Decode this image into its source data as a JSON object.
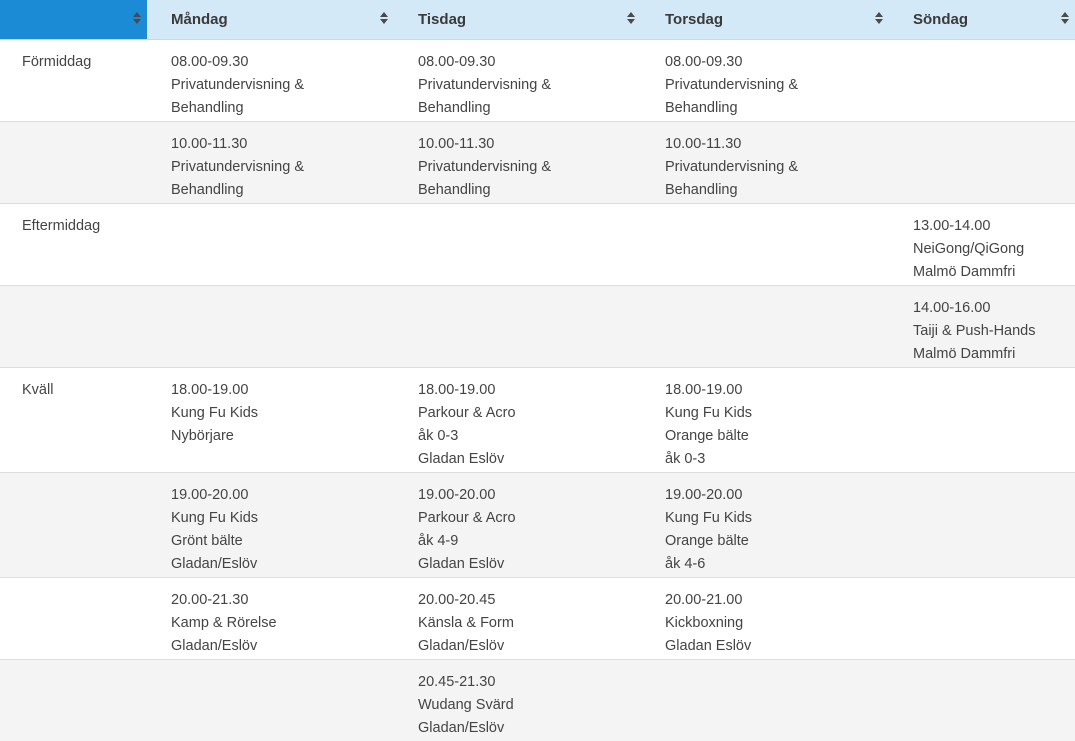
{
  "headers": [
    "",
    "Måndag",
    "Tisdag",
    "Torsdag",
    "Söndag"
  ],
  "rows": [
    {
      "period": "Förmiddag",
      "cells": [
        [
          "08.00-09.30",
          "Privatundervisning &",
          "Behandling"
        ],
        [
          "08.00-09.30",
          "Privatundervisning &",
          "Behandling"
        ],
        [
          "08.00-09.30",
          "Privatundervisning &",
          "Behandling"
        ],
        []
      ]
    },
    {
      "period": "",
      "cells": [
        [
          "10.00-11.30",
          "Privatundervisning &",
          "Behandling"
        ],
        [
          "10.00-11.30",
          "Privatundervisning &",
          "Behandling"
        ],
        [
          "10.00-11.30",
          "Privatundervisning &",
          "Behandling"
        ],
        []
      ]
    },
    {
      "period": "Eftermiddag",
      "cells": [
        [],
        [],
        [],
        [
          "13.00-14.00",
          "NeiGong/QiGong",
          "Malmö Dammfri"
        ]
      ]
    },
    {
      "period": "",
      "cells": [
        [],
        [],
        [],
        [
          "14.00-16.00",
          "Taiji & Push-Hands",
          "Malmö Dammfri"
        ]
      ]
    },
    {
      "period": "Kväll",
      "cells": [
        [
          "18.00-19.00",
          "Kung Fu Kids",
          "Nybörjare"
        ],
        [
          "18.00-19.00",
          "Parkour & Acro",
          "åk 0-3",
          "Gladan Eslöv"
        ],
        [
          "18.00-19.00",
          "Kung Fu Kids",
          "Orange bälte",
          "åk 0-3"
        ],
        []
      ]
    },
    {
      "period": "",
      "cells": [
        [
          "19.00-20.00",
          "Kung Fu Kids",
          "Grönt bälte",
          "Gladan/Eslöv"
        ],
        [
          "19.00-20.00",
          "Parkour & Acro",
          "åk 4-9",
          "Gladan Eslöv"
        ],
        [
          "19.00-20.00",
          "Kung Fu Kids",
          "Orange bälte",
          "åk 4-6"
        ],
        []
      ]
    },
    {
      "period": "",
      "cells": [
        [
          "20.00-21.30",
          "Kamp & Rörelse",
          "Gladan/Eslöv"
        ],
        [
          "20.00-20.45",
          "Känsla & Form",
          "Gladan/Eslöv"
        ],
        [
          "20.00-21.00",
          "Kickboxning",
          "Gladan Eslöv"
        ],
        []
      ]
    },
    {
      "period": "",
      "cells": [
        [],
        [
          "20.45-21.30",
          "Wudang Svärd",
          "Gladan/Eslöv"
        ],
        [],
        []
      ]
    }
  ]
}
